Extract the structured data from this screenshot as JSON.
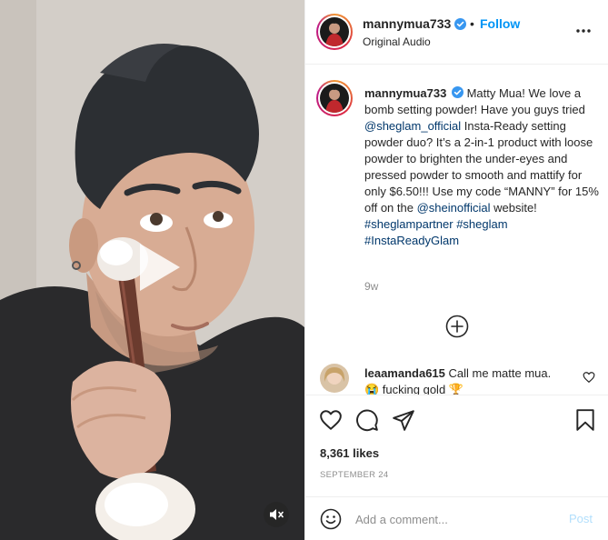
{
  "header": {
    "username": "mannymua733",
    "separator": "•",
    "follow_label": "Follow",
    "audio_label": "Original Audio"
  },
  "caption": {
    "username": "mannymua733",
    "text_1": "Matty Mua! We love a bomb setting powder! Have you guys tried ",
    "mention_1": "@sheglam_official",
    "text_2": " Insta-Ready setting powder duo? It’s a 2-in-1 product with loose powder to brighten the under-eyes and pressed powder to smooth and mattify for only $6.50!!! Use my code “MANNY” for 15% off on the ",
    "mention_2": "@sheinofficial",
    "text_3": " website!",
    "hashtag_1": "#sheglampartner",
    "hashtag_2": "#sheglam",
    "hashtag_3": "#InstaReadyGlam",
    "time_ago": "9w"
  },
  "comment": {
    "username": "leaamanda615",
    "text": "Call me matte mua.",
    "text_line2": "😭 fucking gold 🏆"
  },
  "stats": {
    "likes": "8,361 likes",
    "date": "SEPTEMBER 24"
  },
  "add_comment": {
    "placeholder": "Add a comment...",
    "post_label": "Post"
  },
  "icons": {
    "play": "play-icon",
    "mute": "muted-speaker-icon",
    "more": "more-options-icon",
    "add": "plus-circle-icon",
    "like": "heart-icon",
    "comment": "comment-bubble-icon",
    "share": "paper-plane-icon",
    "save": "bookmark-icon",
    "emoji": "smiley-icon"
  },
  "colors": {
    "link": "#00376b",
    "follow": "#0095f6",
    "post_disabled": "#b2dffc"
  }
}
